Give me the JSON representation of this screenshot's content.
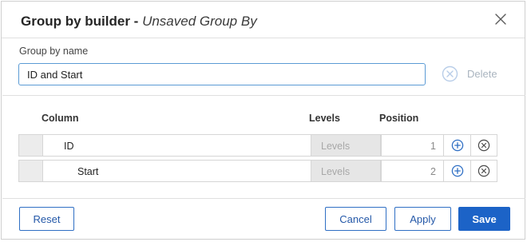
{
  "dialog": {
    "title": "Group by builder",
    "title_separator": " - ",
    "subtitle": "Unsaved Group By"
  },
  "group_name": {
    "label": "Group by name",
    "value": "ID and Start"
  },
  "delete": {
    "label": "Delete"
  },
  "columns_header": {
    "column": "Column",
    "levels": "Levels",
    "position": "Position"
  },
  "rows": [
    {
      "column": "ID",
      "levels_placeholder": "Levels",
      "position": "1"
    },
    {
      "column": "Start",
      "levels_placeholder": "Levels",
      "position": "2"
    }
  ],
  "footer": {
    "reset": "Reset",
    "cancel": "Cancel",
    "apply": "Apply",
    "save": "Save"
  },
  "colors": {
    "accent": "#1c63c7",
    "icon_blue": "#2f6fc4",
    "muted": "#a9b4bf"
  },
  "icons": {
    "close": "close-icon",
    "delete": "circle-x-icon",
    "add": "circle-plus-icon",
    "remove": "circle-x-icon",
    "caret": "caret-down-icon"
  }
}
